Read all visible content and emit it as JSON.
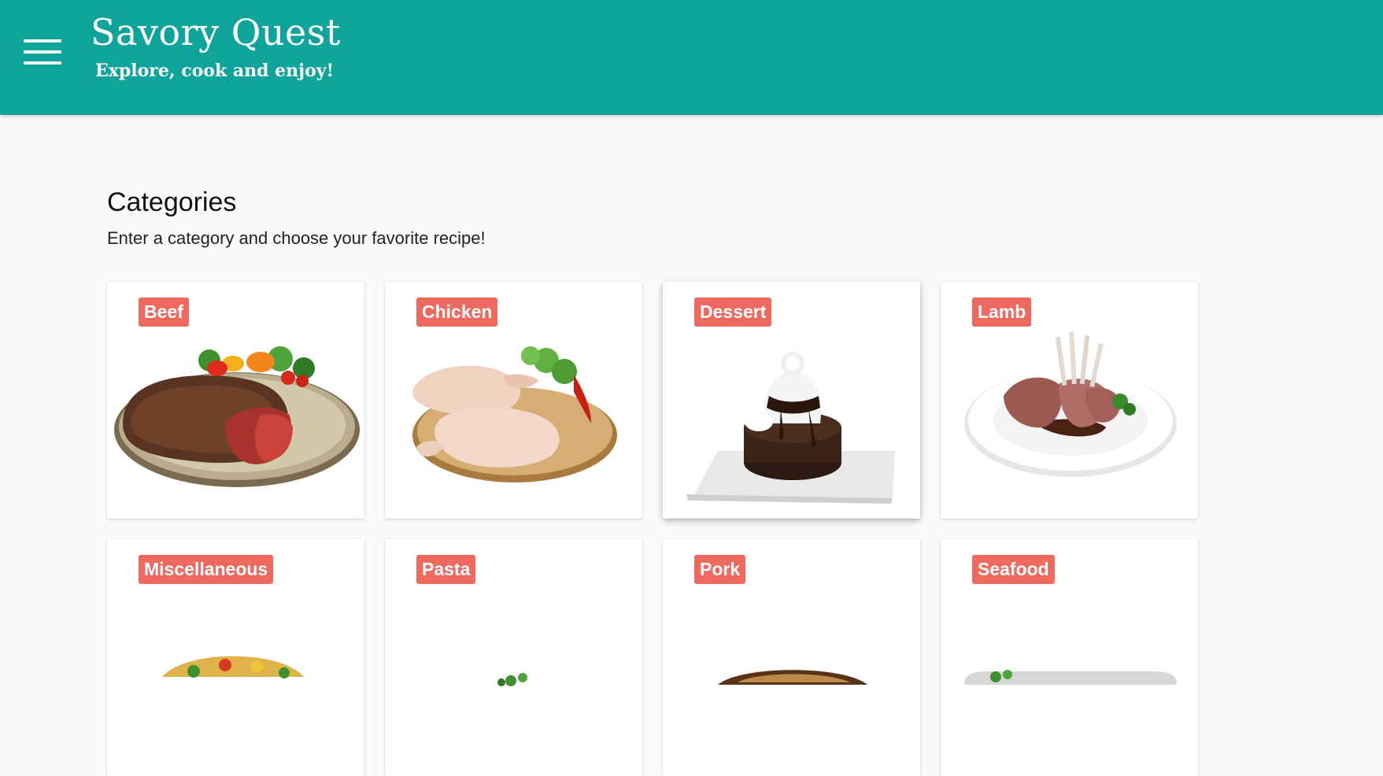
{
  "header": {
    "title": "Savory Quest",
    "tagline": "Explore, cook and enjoy!",
    "menu_icon": "hamburger-menu-icon",
    "background_color": "#0ea39b"
  },
  "main": {
    "heading": "Categories",
    "subheading": "Enter a category and choose your favorite recipe!"
  },
  "categories": [
    {
      "label": "Beef",
      "image": "grilled-steak-plate"
    },
    {
      "label": "Chicken",
      "image": "raw-chicken-legs-board"
    },
    {
      "label": "Dessert",
      "image": "chocolate-lava-cake"
    },
    {
      "label": "Lamb",
      "image": "rack-of-lamb-plate"
    },
    {
      "label": "Miscellaneous",
      "image": "tacos-plate"
    },
    {
      "label": "Pasta",
      "image": "pasta-plate"
    },
    {
      "label": "Pork",
      "image": "pork-dish"
    },
    {
      "label": "Seafood",
      "image": "seafood-plate"
    }
  ],
  "colors": {
    "badge": "#f0695f",
    "page_background": "#fafafa"
  }
}
